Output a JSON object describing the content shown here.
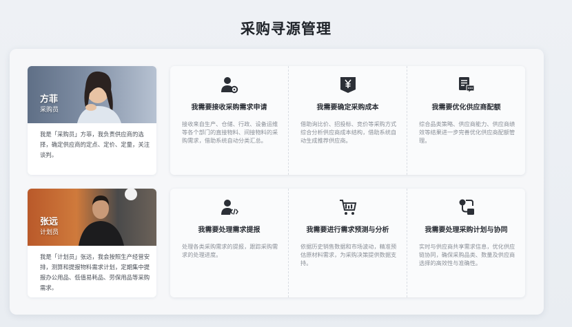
{
  "page": {
    "title": "采购寻源管理"
  },
  "personas": [
    {
      "name": "方菲",
      "role": "采购员",
      "description": "我是「采购员」方菲，我负责供应商的选择，确定供应商的定点、定价、定量，关注谈判。",
      "cards": [
        {
          "icon": "user-settings-icon",
          "title": "我需要接收采购需求申请",
          "description": "接收来自生产、仓储、行政、设备运维等各个部门的直接物料、间接物料的采购需求，借助系统自动分类汇总。"
        },
        {
          "icon": "yen-tag-icon",
          "title": "我需要确定采购成本",
          "description": "借助询比价、招投标、竞价等采购方式综合分析供应商成本结构，借助系统自动生成推荐供应商。"
        },
        {
          "icon": "document-chat-icon",
          "title": "我需要优化供应商配额",
          "description": "综合品类策略、供应商能力、供应商绩效等结果进一步完善优化供应商配额管理。"
        }
      ]
    },
    {
      "name": "张远",
      "role": "计划员",
      "description": "我是「计划员」张远，我会按照生产经营安排，测算和提报物料需求计划，定期集中提报办公用品、低值易耗品、劳保用品等采购需求。",
      "cards": [
        {
          "icon": "user-code-icon",
          "title": "我需要处理需求提报",
          "description": "处理各类采购需求的提报，跟踪采购需求的处理进度。"
        },
        {
          "icon": "shopping-cart-icon",
          "title": "我需要进行需求预测与分析",
          "description": "依据历史销售数据和市场波动，精准预估原材料需求，为采购决策提供数据支持。"
        },
        {
          "icon": "workflow-icon",
          "title": "我需要处理采购计划与协同",
          "description": "实时与供应商共享需求信息，优化供应链协同，确保采购品类、数量及供应商选择的高效性与准确性。"
        }
      ]
    }
  ]
}
